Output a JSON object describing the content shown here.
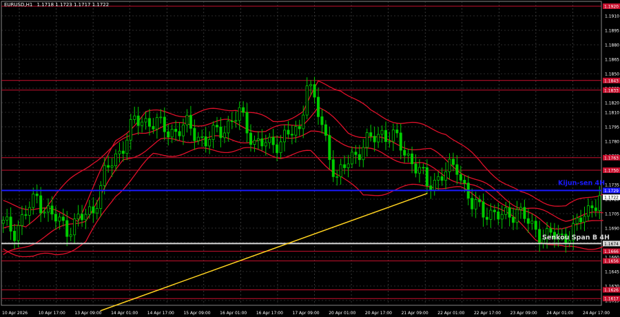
{
  "window": {
    "symbol": "EURUSD,H1",
    "ohlc": "1.1718 1.1723 1.1717 1.1722"
  },
  "colors": {
    "background": "#000000",
    "grid": "#5a5a5a",
    "candle": "#00cc00",
    "ichimoku": "#e0102a",
    "levels": "#c8102e",
    "kijun": "#1a1aff",
    "senkou": "#d9d9d9",
    "trendline": "#ffd21f",
    "axis_text": "#ffffff"
  },
  "chart_data": {
    "type": "candlestick",
    "x_tick_labels": [
      "10 Apr 2026",
      "10 Apr 17:00",
      "13 Apr 09:00",
      "14 Apr 01:00",
      "14 Apr 17:00",
      "15 Apr 09:00",
      "16 Apr 01:00",
      "16 Apr 17:00",
      "17 Apr 09:00",
      "20 Apr 01:00",
      "20 Apr 17:00",
      "21 Apr 09:00",
      "22 Apr 01:00",
      "22 Apr 17:00",
      "23 Apr 09:00",
      "24 Apr 01:00",
      "24 Apr 17:00"
    ],
    "y_tick_labels": [
      "1.1910",
      "1.1895",
      "1.1880",
      "1.1865",
      "1.1850",
      "1.1835",
      "1.1820",
      "1.1810",
      "1.1795",
      "1.1780",
      "1.1765",
      "1.1750",
      "1.1735",
      "1.1720",
      "1.1705",
      "1.1690",
      "1.1675",
      "1.1660",
      "1.1645",
      "1.1630",
      "1.1615"
    ],
    "ylim": [
      1.161,
      1.1925
    ],
    "levels": [
      {
        "label": "1.1920",
        "value": 1.192
      },
      {
        "label": "1.1843",
        "value": 1.1843
      },
      {
        "label": "1.1833",
        "value": 1.1833
      },
      {
        "label": "1.1763",
        "value": 1.1763
      },
      {
        "label": "1.1750",
        "value": 1.175
      },
      {
        "label": "1.1666",
        "value": 1.1666
      },
      {
        "label": "1.1656",
        "value": 1.1656
      },
      {
        "label": "1.1626",
        "value": 1.1626
      },
      {
        "label": "1.1617",
        "value": 1.1617
      }
    ],
    "kijun": {
      "label": "1.1729",
      "value": 1.1729,
      "text": "Kijun-sen 4H"
    },
    "senkou": {
      "label": "1.1674",
      "value": 1.1674,
      "text": "Senkou Span B 4H"
    },
    "current_price": {
      "label": "1.1722",
      "value": 1.1722
    },
    "trendline": {
      "from": [
        0.165,
        1.161
      ],
      "to": [
        0.71,
        1.1726
      ]
    },
    "bars": 160,
    "close_path": [
      [
        0,
        1.1695
      ],
      [
        4,
        1.1688
      ],
      [
        10,
        1.1722
      ],
      [
        14,
        1.1702
      ],
      [
        18,
        1.169
      ],
      [
        22,
        1.17
      ],
      [
        25,
        1.171
      ],
      [
        28,
        1.1745
      ],
      [
        32,
        1.177
      ],
      [
        36,
        1.18
      ],
      [
        40,
        1.1802
      ],
      [
        45,
        1.179
      ],
      [
        50,
        1.1795
      ],
      [
        55,
        1.178
      ],
      [
        60,
        1.1795
      ],
      [
        64,
        1.1808
      ],
      [
        68,
        1.178
      ],
      [
        72,
        1.1775
      ],
      [
        76,
        1.1785
      ],
      [
        80,
        1.179
      ],
      [
        82,
        1.1845
      ],
      [
        86,
        1.1795
      ],
      [
        90,
        1.174
      ],
      [
        94,
        1.1765
      ],
      [
        98,
        1.1778
      ],
      [
        102,
        1.179
      ],
      [
        106,
        1.178
      ],
      [
        110,
        1.176
      ],
      [
        114,
        1.1735
      ],
      [
        118,
        1.1745
      ],
      [
        122,
        1.1755
      ],
      [
        126,
        1.1712
      ],
      [
        130,
        1.1708
      ],
      [
        134,
        1.17
      ],
      [
        138,
        1.171
      ],
      [
        142,
        1.169
      ],
      [
        146,
        1.1682
      ],
      [
        150,
        1.168
      ],
      [
        154,
        1.1692
      ],
      [
        158,
        1.1715
      ],
      [
        160,
        1.1722
      ]
    ],
    "ichimoku_lines": [
      [
        [
          0,
          1.169
        ],
        [
          6,
          1.169
        ],
        [
          14,
          1.1725
        ],
        [
          24,
          1.176
        ],
        [
          36,
          1.179
        ],
        [
          48,
          1.1798
        ],
        [
          60,
          1.18
        ],
        [
          70,
          1.179
        ],
        [
          80,
          1.18
        ],
        [
          84,
          1.1815
        ],
        [
          92,
          1.179
        ],
        [
          104,
          1.1778
        ],
        [
          114,
          1.177
        ],
        [
          126,
          1.174
        ],
        [
          138,
          1.1712
        ],
        [
          150,
          1.17
        ],
        [
          160,
          1.1705
        ]
      ],
      [
        [
          0,
          1.166
        ],
        [
          10,
          1.168
        ],
        [
          22,
          1.17
        ],
        [
          32,
          1.176
        ],
        [
          42,
          1.178
        ],
        [
          56,
          1.1783
        ],
        [
          70,
          1.178
        ],
        [
          82,
          1.179
        ],
        [
          90,
          1.178
        ],
        [
          102,
          1.1765
        ],
        [
          112,
          1.1755
        ],
        [
          124,
          1.1735
        ],
        [
          136,
          1.1712
        ],
        [
          146,
          1.1692
        ],
        [
          154,
          1.1692
        ],
        [
          160,
          1.17
        ]
      ],
      [
        [
          0,
          1.1716
        ],
        [
          10,
          1.171
        ],
        [
          20,
          1.17
        ],
        [
          30,
          1.178
        ],
        [
          38,
          1.181
        ],
        [
          50,
          1.1808
        ],
        [
          62,
          1.1815
        ],
        [
          72,
          1.18
        ],
        [
          80,
          1.181
        ],
        [
          84,
          1.184
        ],
        [
          90,
          1.1835
        ],
        [
          98,
          1.181
        ],
        [
          106,
          1.18
        ],
        [
          118,
          1.179
        ],
        [
          128,
          1.1755
        ],
        [
          138,
          1.1725
        ],
        [
          150,
          1.1712
        ],
        [
          160,
          1.1728
        ]
      ],
      [
        [
          0,
          1.1668
        ],
        [
          8,
          1.166
        ],
        [
          14,
          1.1662
        ],
        [
          22,
          1.1675
        ],
        [
          30,
          1.1725
        ],
        [
          40,
          1.1765
        ],
        [
          52,
          1.177
        ],
        [
          64,
          1.1772
        ],
        [
          74,
          1.1765
        ],
        [
          82,
          1.1768
        ],
        [
          90,
          1.1745
        ],
        [
          96,
          1.1722
        ],
        [
          104,
          1.173
        ],
        [
          114,
          1.1735
        ],
        [
          122,
          1.173
        ],
        [
          132,
          1.1712
        ],
        [
          142,
          1.168
        ],
        [
          150,
          1.1668
        ],
        [
          160,
          1.1672
        ]
      ]
    ]
  }
}
